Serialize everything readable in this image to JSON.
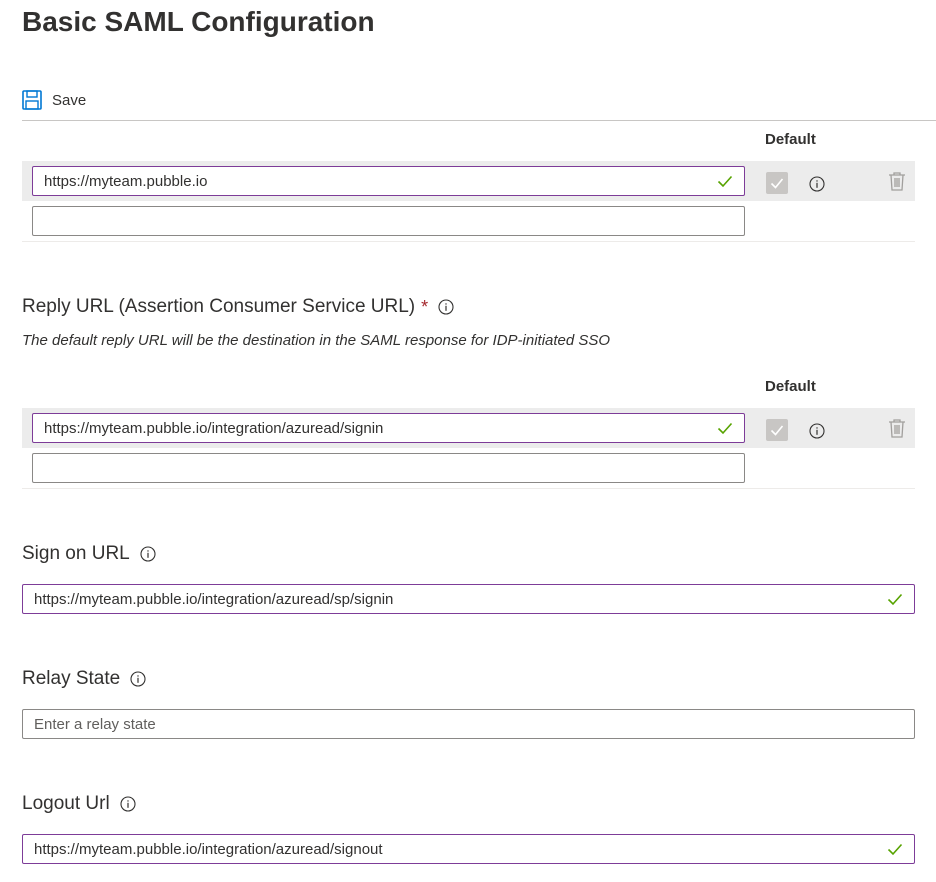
{
  "page": {
    "title": "Basic SAML Configuration"
  },
  "toolbar": {
    "save_label": "Save"
  },
  "identifier": {
    "default_header": "Default",
    "entries": [
      {
        "value": "https://myteam.pubble.io",
        "valid": true,
        "is_default": true
      },
      {
        "value": "",
        "valid": false
      }
    ]
  },
  "reply_url": {
    "label": "Reply URL (Assertion Consumer Service URL)",
    "required_mark": "*",
    "description": "The default reply URL will be the destination in the SAML response for IDP-initiated SSO",
    "default_header": "Default",
    "entries": [
      {
        "value": "https://myteam.pubble.io/integration/azuread/signin",
        "valid": true,
        "is_default": true
      },
      {
        "value": "",
        "valid": false
      }
    ]
  },
  "sign_on_url": {
    "label": "Sign on URL",
    "value": "https://myteam.pubble.io/integration/azuread/sp/signin",
    "valid": true
  },
  "relay_state": {
    "label": "Relay State",
    "value": "",
    "placeholder": "Enter a relay state"
  },
  "logout_url": {
    "label": "Logout Url",
    "value": "https://myteam.pubble.io/integration/azuread/signout",
    "valid": true
  },
  "colors": {
    "valid_border": "#7d3c98",
    "valid_check": "#57a300",
    "save_icon": "#0078d4",
    "required": "#a4262c"
  },
  "icons": [
    "save-icon",
    "checkmark-icon",
    "info-icon",
    "trash-icon"
  ]
}
